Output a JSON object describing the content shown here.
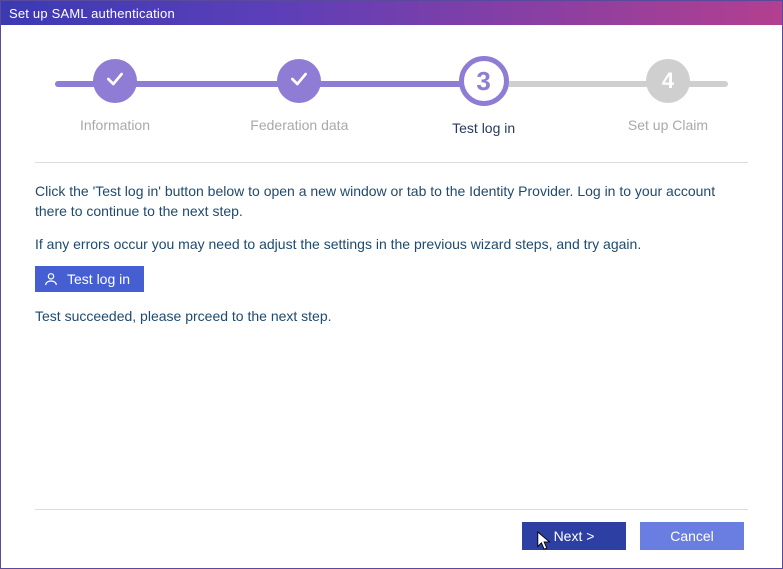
{
  "window": {
    "title": "Set up SAML authentication"
  },
  "stepper": {
    "steps": [
      {
        "label": "Information",
        "state": "done"
      },
      {
        "label": "Federation data",
        "state": "done"
      },
      {
        "label": "Test log in",
        "state": "current",
        "number": "3"
      },
      {
        "label": "Set up Claim",
        "state": "future",
        "number": "4"
      }
    ]
  },
  "content": {
    "para1": "Click the 'Test log in' button below to open a new window or tab to the Identity Provider. Log in to your account there to continue to the next step.",
    "para2": "If any errors occur you may need to adjust the settings in the previous wizard steps, and try again.",
    "test_button_label": "Test log in",
    "result_text": "Test succeeded, please prceed to the next step."
  },
  "footer": {
    "next_label": "Next >",
    "cancel_label": "Cancel"
  }
}
